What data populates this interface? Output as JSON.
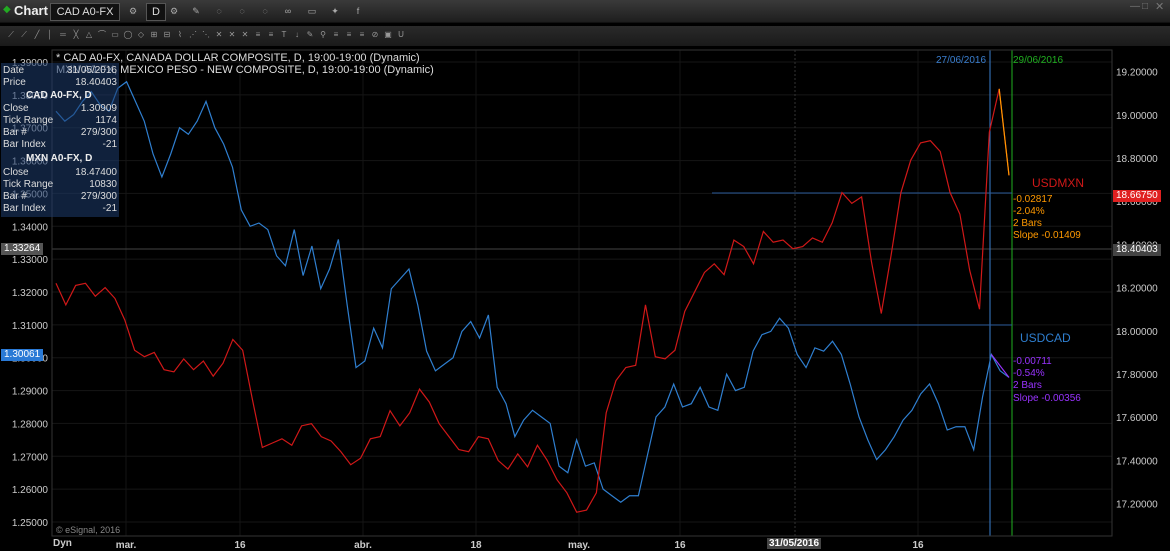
{
  "app": {
    "title": "Chart",
    "symbol": "CAD A0-FX",
    "interval": "D"
  },
  "study_legend": [
    "* CAD A0-FX, CANADA DOLLAR COMPOSITE, D, 19:00-19:00 (Dynamic)",
    "MXN A0-FX, MEXICO PESO - NEW COMPOSITE, D, 19:00-19:00 (Dynamic)"
  ],
  "infobox": {
    "date_label": "Date",
    "date": "31/05/2016",
    "price_label": "Price",
    "price": "18.40403",
    "cad_title": "CAD A0-FX, D",
    "cad": [
      [
        "Close",
        "1.30909"
      ],
      [
        "Tick Range",
        "1174"
      ],
      [
        "Bar #",
        "279/300"
      ],
      [
        "Bar Index",
        "-21"
      ]
    ],
    "mxn_title": "MXN A0-FX, D",
    "mxn": [
      [
        "Close",
        "18.47400"
      ],
      [
        "Tick Range",
        "10830"
      ],
      [
        "Bar #",
        "279/300"
      ],
      [
        "Bar Index",
        "-21"
      ]
    ]
  },
  "markers": {
    "date1": "27/06/2016",
    "date2": "29/06/2016",
    "cursor_date": "31/05/2016"
  },
  "usdmxn": {
    "label": "USDMXN",
    "change": "-0.02817",
    "pct": "-2.04%",
    "bars": "2 Bars",
    "slope": "Slope -0.01409",
    "last": "18.66750"
  },
  "usdcad": {
    "label": "USDCAD",
    "change": "-0.00711",
    "pct": "-0.54%",
    "bars": "2 Bars",
    "slope": "Slope -0.00356",
    "last": "1.30061"
  },
  "cursor_left_price": "1.33264",
  "cursor_right_price": "18.40403",
  "copyright": "© eSignal, 2016",
  "x_axis_start": "Dyn",
  "colors": {
    "cad": "#2f7fd0",
    "mxn": "#d01818",
    "mxn_trend": "#ff9900",
    "cad_trend": "#9933ff",
    "date1": "#3a7fd0",
    "date2": "#20b020"
  },
  "chart_data": {
    "type": "line",
    "left_axis": {
      "ticks": [
        "1.39000",
        "1.38000",
        "1.37000",
        "1.36000",
        "1.35000",
        "1.34000",
        "1.33000",
        "1.32000",
        "1.31000",
        "1.30000",
        "1.29000",
        "1.28000",
        "1.27000",
        "1.26000",
        "1.25000"
      ],
      "ylim": [
        1.25,
        1.39
      ]
    },
    "right_axis": {
      "ticks": [
        "19.20000",
        "19.00000",
        "18.80000",
        "18.60000",
        "18.40000",
        "18.20000",
        "18.00000",
        "17.80000",
        "17.60000",
        "17.40000",
        "17.20000"
      ],
      "ylim": [
        17.05,
        19.3
      ]
    },
    "x_ticks": [
      "mar.",
      "16",
      "abr.",
      "18",
      "may.",
      "16",
      "31/05/2016",
      "16"
    ],
    "series": [
      {
        "name": "USDCAD",
        "values": [
          1.375,
          1.372,
          1.374,
          1.378,
          1.381,
          1.377,
          1.375,
          1.382,
          1.384,
          1.378,
          1.372,
          1.362,
          1.355,
          1.362,
          1.37,
          1.368,
          1.372,
          1.378,
          1.37,
          1.365,
          1.358,
          1.345,
          1.34,
          1.341,
          1.339,
          1.331,
          1.328,
          1.339,
          1.325,
          1.334,
          1.321,
          1.327,
          1.336,
          1.316,
          1.297,
          1.299,
          1.309,
          1.303,
          1.321,
          1.324,
          1.327,
          1.316,
          1.302,
          1.296,
          1.298,
          1.3,
          1.308,
          1.311,
          1.306,
          1.313,
          1.291,
          1.286,
          1.276,
          1.281,
          1.284,
          1.282,
          1.28,
          1.267,
          1.265,
          1.275,
          1.267,
          1.268,
          1.26,
          1.258,
          1.256,
          1.258,
          1.258,
          1.27,
          1.282,
          1.285,
          1.292,
          1.285,
          1.286,
          1.291,
          1.285,
          1.284,
          1.295,
          1.29,
          1.291,
          1.302,
          1.307,
          1.308,
          1.312,
          1.309,
          1.301,
          1.297,
          1.303,
          1.302,
          1.305,
          1.301,
          1.292,
          1.282,
          1.275,
          1.269,
          1.272,
          1.276,
          1.281,
          1.284,
          1.289,
          1.292,
          1.286,
          1.278,
          1.279,
          1.279,
          1.272,
          1.288,
          1.301,
          1.296,
          1.294
        ]
      },
      {
        "name": "USDMXN",
        "values": [
          18.22,
          18.12,
          18.21,
          18.22,
          18.16,
          18.2,
          18.15,
          18.05,
          17.91,
          17.88,
          17.9,
          17.82,
          17.81,
          17.87,
          17.82,
          17.86,
          17.79,
          17.85,
          17.96,
          17.91,
          17.68,
          17.46,
          17.48,
          17.5,
          17.47,
          17.56,
          17.57,
          17.51,
          17.49,
          17.44,
          17.38,
          17.41,
          17.5,
          17.51,
          17.63,
          17.56,
          17.62,
          17.73,
          17.67,
          17.57,
          17.51,
          17.45,
          17.44,
          17.51,
          17.5,
          17.4,
          17.36,
          17.43,
          17.37,
          17.47,
          17.4,
          17.31,
          17.25,
          17.16,
          17.17,
          17.25,
          17.62,
          17.77,
          17.83,
          17.84,
          18.12,
          17.88,
          17.87,
          17.91,
          18.09,
          18.18,
          18.27,
          18.31,
          18.26,
          18.42,
          18.39,
          18.31,
          18.46,
          18.41,
          18.42,
          18.38,
          18.39,
          18.43,
          18.41,
          18.5,
          18.64,
          18.59,
          18.62,
          18.32,
          18.08,
          18.35,
          18.64,
          18.79,
          18.87,
          18.88,
          18.83,
          18.64,
          18.54,
          18.28,
          18.1,
          18.92,
          19.12,
          18.72
        ]
      }
    ]
  }
}
